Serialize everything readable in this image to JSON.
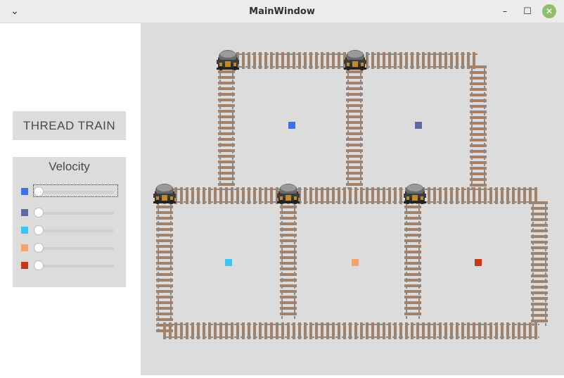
{
  "window": {
    "title": "MainWindow"
  },
  "left_panel": {
    "title_button": "THREAD TRAIN",
    "velocity_label": "Velocity",
    "sliders": [
      {
        "color": "#3f6ef0",
        "value": 0
      },
      {
        "color": "#5e6aa0",
        "value": 0
      },
      {
        "color": "#38c6f4",
        "value": 0
      },
      {
        "color": "#f7a26a",
        "value": 0
      },
      {
        "color": "#c8371b",
        "value": 0
      }
    ]
  },
  "canvas": {
    "background": "#dcdcdc",
    "rail_color": "#a4826a",
    "trains": 5,
    "square_markers": [
      "#3f6ef0",
      "#5e6aa0",
      "#38c6f4",
      "#f7a26a",
      "#c8371b"
    ]
  }
}
